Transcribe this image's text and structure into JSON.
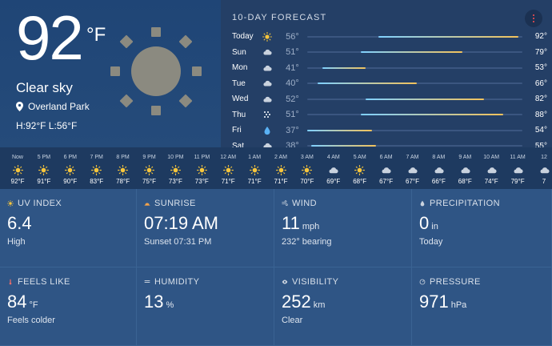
{
  "current": {
    "temp": "92",
    "unit": "°F",
    "condition": "Clear sky",
    "location": "Overland Park",
    "hilo": "H:92°F  L:56°F"
  },
  "forecast": {
    "title": "10-DAY FORECAST",
    "days": [
      {
        "day": "Today",
        "icon": "sun-icon",
        "low": "56°",
        "high": "92°",
        "range": [
          0.33,
          0.98
        ]
      },
      {
        "day": "Sun",
        "icon": "cloud-icon",
        "low": "51°",
        "high": "79°",
        "range": [
          0.25,
          0.72
        ]
      },
      {
        "day": "Mon",
        "icon": "cloud-icon",
        "low": "41°",
        "high": "53°",
        "range": [
          0.07,
          0.27
        ]
      },
      {
        "day": "Tue",
        "icon": "cloud-icon",
        "low": "40°",
        "high": "66°",
        "range": [
          0.05,
          0.51
        ]
      },
      {
        "day": "Wed",
        "icon": "cloud-icon",
        "low": "52°",
        "high": "82°",
        "range": [
          0.27,
          0.82
        ]
      },
      {
        "day": "Thu",
        "icon": "snow-icon",
        "low": "51°",
        "high": "88°",
        "range": [
          0.25,
          0.91
        ]
      },
      {
        "day": "Fri",
        "icon": "rain-drop-icon",
        "low": "37°",
        "high": "54°",
        "range": [
          0.0,
          0.3
        ]
      },
      {
        "day": "Sat",
        "icon": "cloud-icon",
        "low": "38°",
        "high": "55°",
        "range": [
          0.02,
          0.32
        ]
      }
    ]
  },
  "hourly": [
    {
      "time": "Now",
      "icon": "sun-icon",
      "temp": "92°F"
    },
    {
      "time": "5 PM",
      "icon": "sun-icon",
      "temp": "91°F"
    },
    {
      "time": "6 PM",
      "icon": "sun-icon",
      "temp": "90°F"
    },
    {
      "time": "7 PM",
      "icon": "sun-icon",
      "temp": "83°F"
    },
    {
      "time": "8 PM",
      "icon": "sun-icon",
      "temp": "78°F"
    },
    {
      "time": "9 PM",
      "icon": "sun-icon",
      "temp": "75°F"
    },
    {
      "time": "10 PM",
      "icon": "sun-icon",
      "temp": "73°F"
    },
    {
      "time": "11 PM",
      "icon": "sun-icon",
      "temp": "73°F"
    },
    {
      "time": "12 AM",
      "icon": "sun-icon",
      "temp": "71°F"
    },
    {
      "time": "1 AM",
      "icon": "sun-icon",
      "temp": "71°F"
    },
    {
      "time": "2 AM",
      "icon": "sun-icon",
      "temp": "71°F"
    },
    {
      "time": "3 AM",
      "icon": "sun-icon",
      "temp": "70°F"
    },
    {
      "time": "4 AM",
      "icon": "cloud-icon",
      "temp": "69°F"
    },
    {
      "time": "5 AM",
      "icon": "sun-icon",
      "temp": "68°F"
    },
    {
      "time": "6 AM",
      "icon": "cloud-icon",
      "temp": "67°F"
    },
    {
      "time": "7 AM",
      "icon": "cloud-icon",
      "temp": "67°F"
    },
    {
      "time": "8 AM",
      "icon": "cloud-icon",
      "temp": "66°F"
    },
    {
      "time": "9 AM",
      "icon": "cloud-icon",
      "temp": "68°F"
    },
    {
      "time": "10 AM",
      "icon": "cloud-icon",
      "temp": "74°F"
    },
    {
      "time": "11 AM",
      "icon": "cloud-icon",
      "temp": "79°F"
    },
    {
      "time": "12",
      "icon": "cloud-icon",
      "temp": "7"
    }
  ],
  "tiles": [
    {
      "label": "UV INDEX",
      "icon": "sun-small-icon",
      "value": "6.4",
      "unit": "",
      "sub": "High"
    },
    {
      "label": "SUNRISE",
      "icon": "sunrise-icon",
      "value": "07:19 AM",
      "unit": "",
      "sub": "Sunset 07:31 PM"
    },
    {
      "label": "WIND",
      "icon": "wind-icon",
      "value": "11",
      "unit": "mph",
      "sub": "232° bearing"
    },
    {
      "label": "PRECIPITATION",
      "icon": "drop-icon",
      "value": "0",
      "unit": "in",
      "sub": "Today"
    },
    {
      "label": "FEELS LIKE",
      "icon": "thermometer-icon",
      "value": "84",
      "unit": "°F",
      "sub": "Feels colder"
    },
    {
      "label": "HUMIDITY",
      "icon": "humidity-icon",
      "value": "13",
      "unit": "%",
      "sub": ""
    },
    {
      "label": "VISIBILITY",
      "icon": "eye-icon",
      "value": "252",
      "unit": "km",
      "sub": "Clear"
    },
    {
      "label": "PRESSURE",
      "icon": "gauge-icon",
      "value": "971",
      "unit": "hPa",
      "sub": ""
    }
  ]
}
